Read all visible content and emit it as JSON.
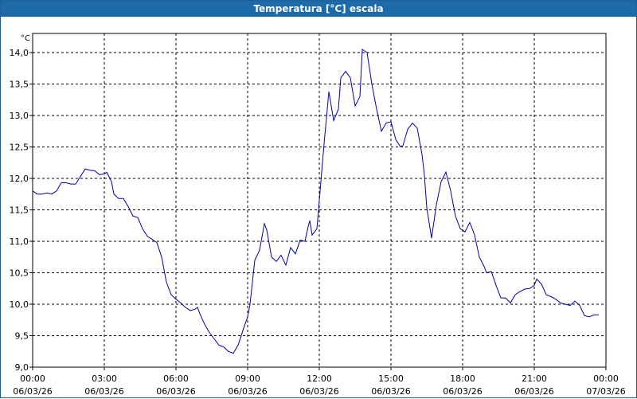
{
  "window": {
    "title": "Temperatura [°C] escala"
  },
  "chart_data": {
    "type": "line",
    "title": "Temperatura [°C] escala",
    "ylabel": "°C",
    "xlabel": "",
    "ylim": [
      9.0,
      14.2
    ],
    "xlim_hours": [
      0,
      24
    ],
    "grid": true,
    "y_ticks": [
      "9,0",
      "9,5",
      "10,0",
      "10,5",
      "11,0",
      "11,5",
      "12,0",
      "12,5",
      "13,0",
      "13,5",
      "14,0"
    ],
    "x_ticks": [
      {
        "time": "00:00",
        "date": "06/03/26"
      },
      {
        "time": "03:00",
        "date": "06/03/26"
      },
      {
        "time": "06:00",
        "date": "06/03/26"
      },
      {
        "time": "09:00",
        "date": "06/03/26"
      },
      {
        "time": "12:00",
        "date": "06/03/26"
      },
      {
        "time": "15:00",
        "date": "06/03/26"
      },
      {
        "time": "18:00",
        "date": "06/03/26"
      },
      {
        "time": "21:00",
        "date": "06/03/26"
      },
      {
        "time": "00:00",
        "date": "07/03/26"
      }
    ],
    "series": [
      {
        "color": "#0000aa",
        "points": [
          [
            "00:00",
            11.8
          ],
          [
            "00:12",
            11.75
          ],
          [
            "00:24",
            11.75
          ],
          [
            "00:36",
            11.77
          ],
          [
            "00:48",
            11.75
          ],
          [
            "01:00",
            11.8
          ],
          [
            "01:12",
            11.93
          ],
          [
            "01:24",
            11.93
          ],
          [
            "01:36",
            11.91
          ],
          [
            "01:48",
            11.91
          ],
          [
            "02:00",
            12.03
          ],
          [
            "02:12",
            12.15
          ],
          [
            "02:24",
            12.13
          ],
          [
            "02:36",
            12.12
          ],
          [
            "02:48",
            12.06
          ],
          [
            "03:00",
            12.07
          ],
          [
            "03:06",
            12.1
          ],
          [
            "03:18",
            11.95
          ],
          [
            "03:24",
            11.75
          ],
          [
            "03:36",
            11.68
          ],
          [
            "03:48",
            11.68
          ],
          [
            "04:00",
            11.55
          ],
          [
            "04:12",
            11.4
          ],
          [
            "04:24",
            11.38
          ],
          [
            "04:36",
            11.2
          ],
          [
            "04:48",
            11.08
          ],
          [
            "05:00",
            11.03
          ],
          [
            "05:12",
            10.98
          ],
          [
            "05:24",
            10.75
          ],
          [
            "05:36",
            10.35
          ],
          [
            "05:48",
            10.15
          ],
          [
            "06:00",
            10.08
          ],
          [
            "06:12",
            10.02
          ],
          [
            "06:24",
            9.95
          ],
          [
            "06:36",
            9.9
          ],
          [
            "06:48",
            9.92
          ],
          [
            "06:54",
            9.95
          ],
          [
            "07:00",
            9.85
          ],
          [
            "07:12",
            9.68
          ],
          [
            "07:24",
            9.55
          ],
          [
            "07:36",
            9.45
          ],
          [
            "07:48",
            9.35
          ],
          [
            "08:00",
            9.32
          ],
          [
            "08:12",
            9.25
          ],
          [
            "08:24",
            9.22
          ],
          [
            "08:36",
            9.35
          ],
          [
            "08:48",
            9.58
          ],
          [
            "09:00",
            9.8
          ],
          [
            "09:06",
            10.0
          ],
          [
            "09:18",
            10.7
          ],
          [
            "09:30",
            10.86
          ],
          [
            "09:42",
            11.28
          ],
          [
            "09:48",
            11.18
          ],
          [
            "10:00",
            10.75
          ],
          [
            "10:12",
            10.68
          ],
          [
            "10:24",
            10.78
          ],
          [
            "10:36",
            10.62
          ],
          [
            "10:48",
            10.9
          ],
          [
            "11:00",
            10.8
          ],
          [
            "11:12",
            11.02
          ],
          [
            "11:24",
            11.0
          ],
          [
            "11:30",
            11.18
          ],
          [
            "11:36",
            11.33
          ],
          [
            "11:42",
            11.1
          ],
          [
            "11:54",
            11.2
          ],
          [
            "12:00",
            11.65
          ],
          [
            "12:12",
            12.55
          ],
          [
            "12:24",
            13.38
          ],
          [
            "12:36",
            12.92
          ],
          [
            "12:48",
            13.1
          ],
          [
            "12:54",
            13.6
          ],
          [
            "13:06",
            13.7
          ],
          [
            "13:18",
            13.6
          ],
          [
            "13:30",
            13.15
          ],
          [
            "13:42",
            13.3
          ],
          [
            "13:48",
            14.05
          ],
          [
            "14:00",
            14.0
          ],
          [
            "14:12",
            13.5
          ],
          [
            "14:24",
            13.1
          ],
          [
            "14:36",
            12.75
          ],
          [
            "14:48",
            12.88
          ],
          [
            "15:00",
            12.9
          ],
          [
            "15:12",
            12.62
          ],
          [
            "15:24",
            12.5
          ],
          [
            "15:30",
            12.52
          ],
          [
            "15:42",
            12.78
          ],
          [
            "15:54",
            12.88
          ],
          [
            "16:06",
            12.8
          ],
          [
            "16:18",
            12.38
          ],
          [
            "16:24",
            12.05
          ],
          [
            "16:30",
            11.53
          ],
          [
            "16:42",
            11.05
          ],
          [
            "16:54",
            11.58
          ],
          [
            "17:06",
            11.95
          ],
          [
            "17:18",
            12.1
          ],
          [
            "17:30",
            11.8
          ],
          [
            "17:42",
            11.4
          ],
          [
            "17:54",
            11.2
          ],
          [
            "18:06",
            11.15
          ],
          [
            "18:18",
            11.3
          ],
          [
            "18:30",
            11.1
          ],
          [
            "18:42",
            10.75
          ],
          [
            "18:54",
            10.6
          ],
          [
            "19:00",
            10.5
          ],
          [
            "19:12",
            10.52
          ],
          [
            "19:24",
            10.3
          ],
          [
            "19:36",
            10.1
          ],
          [
            "19:48",
            10.1
          ],
          [
            "20:00",
            10.02
          ],
          [
            "20:12",
            10.15
          ],
          [
            "20:24",
            10.2
          ],
          [
            "20:36",
            10.24
          ],
          [
            "20:48",
            10.25
          ],
          [
            "21:00",
            10.3
          ],
          [
            "21:06",
            10.4
          ],
          [
            "21:18",
            10.32
          ],
          [
            "21:30",
            10.15
          ],
          [
            "21:42",
            10.12
          ],
          [
            "21:54",
            10.08
          ],
          [
            "22:06",
            10.02
          ],
          [
            "22:18",
            10.0
          ],
          [
            "22:30",
            9.98
          ],
          [
            "22:42",
            10.05
          ],
          [
            "22:54",
            9.98
          ],
          [
            "23:06",
            9.82
          ],
          [
            "23:18",
            9.8
          ],
          [
            "23:30",
            9.83
          ],
          [
            "23:42",
            9.83
          ]
        ]
      }
    ]
  }
}
